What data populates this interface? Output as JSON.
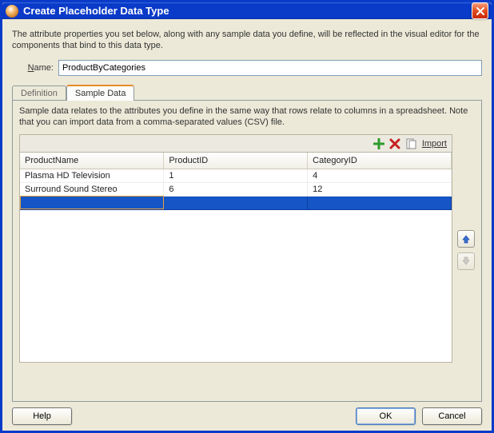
{
  "window": {
    "title": "Create Placeholder Data Type"
  },
  "intro_text": "The attribute properties you set below, along with any sample data you define, will be reflected in the visual editor for the components that bind to this data type.",
  "name_field": {
    "label": "Name:",
    "value": "ProductByCategories"
  },
  "tabs": {
    "definition": "Definition",
    "sample_data": "Sample Data"
  },
  "sample_desc": "Sample data relates to the attributes you define in the same way that rows relate to columns in a spreadsheet. Note that you can import data from a comma-separated values (CSV) file.",
  "toolbar": {
    "import_label": "Import"
  },
  "table": {
    "columns": [
      "ProductName",
      "ProductID",
      "CategoryID"
    ],
    "rows": [
      {
        "c0": "Plasma HD Television",
        "c1": "1",
        "c2": "4"
      },
      {
        "c0": "Surround Sound Stereo",
        "c1": "6",
        "c2": "12"
      },
      {
        "c0": "",
        "c1": "",
        "c2": ""
      }
    ],
    "selected_index": 2
  },
  "buttons": {
    "help": "Help",
    "ok": "OK",
    "cancel": "Cancel"
  }
}
